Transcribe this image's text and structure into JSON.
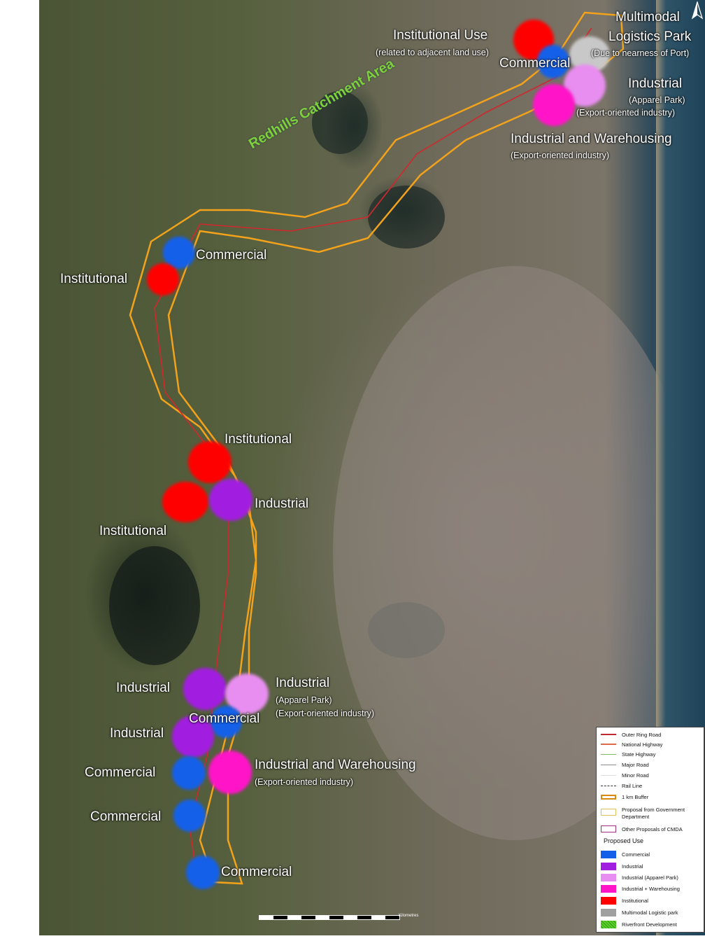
{
  "map": {
    "catchment_label": "Redhills Catchment Area",
    "labels": [
      {
        "text": "Institutional  Use",
        "size": "big"
      },
      {
        "text": "(related to adjacent land use)",
        "size": "small"
      },
      {
        "text": "Multimodal",
        "size": "big"
      },
      {
        "text": "Logistics Park",
        "size": "big"
      },
      {
        "text": "(Due to nearness of Port)",
        "size": "small"
      },
      {
        "text": "Commercial",
        "size": "big"
      },
      {
        "text": "Industrial",
        "size": "big"
      },
      {
        "text": "(Apparel Park)",
        "size": "small"
      },
      {
        "text": "(Export-oriented  industry)",
        "size": "small"
      },
      {
        "text": "Industrial and Warehousing",
        "size": "big"
      },
      {
        "text": "(Export-oriented  industry)",
        "size": "small"
      },
      {
        "text": "Commercial",
        "size": "big"
      },
      {
        "text": "Institutional",
        "size": "big"
      },
      {
        "text": "Institutional",
        "size": "big"
      },
      {
        "text": "Industrial",
        "size": "big"
      },
      {
        "text": "Institutional",
        "size": "big"
      },
      {
        "text": "Industrial",
        "size": "big"
      },
      {
        "text": "Industrial",
        "size": "big"
      },
      {
        "text": "(Apparel Park)",
        "size": "small"
      },
      {
        "text": "(Export-oriented  industry)",
        "size": "small"
      },
      {
        "text": "Commercial",
        "size": "big"
      },
      {
        "text": "Industrial",
        "size": "big"
      },
      {
        "text": "Commercial",
        "size": "big"
      },
      {
        "text": "Industrial and Warehousing",
        "size": "big"
      },
      {
        "text": "(Export-oriented  industry)",
        "size": "small"
      },
      {
        "text": "Commercial",
        "size": "big"
      },
      {
        "text": "Commercial",
        "size": "big"
      }
    ],
    "markers": [
      {
        "use": "Institutional",
        "color": "#ff0000"
      },
      {
        "use": "Multimodal Logistic park",
        "color": "#c8c8c8"
      },
      {
        "use": "Commercial",
        "color": "#1560e8"
      },
      {
        "use": "Industrial (Apparel Park)",
        "color": "#e88ef0"
      },
      {
        "use": "Industrial + Warehousing",
        "color": "#ff14c8"
      },
      {
        "use": "Commercial",
        "color": "#1560e8"
      },
      {
        "use": "Institutional",
        "color": "#ff0000"
      },
      {
        "use": "Institutional",
        "color": "#ff0000"
      },
      {
        "use": "Institutional",
        "color": "#ff0000"
      },
      {
        "use": "Industrial",
        "color": "#a11ee0"
      },
      {
        "use": "Industrial",
        "color": "#a11ee0"
      },
      {
        "use": "Industrial (Apparel Park)",
        "color": "#e88ef0"
      },
      {
        "use": "Commercial",
        "color": "#1560e8"
      },
      {
        "use": "Industrial",
        "color": "#a11ee0"
      },
      {
        "use": "Commercial",
        "color": "#1560e8"
      },
      {
        "use": "Industrial + Warehousing",
        "color": "#ff14c8"
      },
      {
        "use": "Commercial",
        "color": "#1560e8"
      },
      {
        "use": "Commercial",
        "color": "#1560e8"
      }
    ],
    "buffer_color": "#f2a21b",
    "scale_unit": "Kilometres"
  },
  "legend": {
    "lines": [
      {
        "label": "Outer Ring Road",
        "style": "solid",
        "color": "#c0282d"
      },
      {
        "label": "National Highway",
        "style": "solid",
        "color": "#e06a4a"
      },
      {
        "label": "State Highway",
        "style": "solid",
        "color": "#7cba5a"
      },
      {
        "label": "Major Road",
        "style": "solid",
        "color": "#8a8a8a"
      },
      {
        "label": "Minor Road",
        "style": "solid",
        "color": "#ffffff"
      },
      {
        "label": "Rail Line",
        "style": "dashed",
        "color": "#333333"
      },
      {
        "label": "1 km Buffer",
        "style": "box",
        "color": "#d88a10"
      },
      {
        "label": "Proposal from Government Department",
        "style": "box",
        "color": "#d9c060"
      },
      {
        "label": "Other Proposals of CMDA",
        "style": "box",
        "color": "#a0307a"
      }
    ],
    "heading": "Proposed Use",
    "uses": [
      {
        "label": "Commercial",
        "color": "#1560e8"
      },
      {
        "label": "Industrial",
        "color": "#a11ee0"
      },
      {
        "label": "Industrial (Apparel Park)",
        "color": "#e88ef0"
      },
      {
        "label": "Industrial + Warehousing",
        "color": "#ff14c8"
      },
      {
        "label": "Institutional",
        "color": "#ff0000"
      },
      {
        "label": "Multimodal Logistic park",
        "color": "#a0a0a0"
      },
      {
        "label": "Riverfront Development",
        "color": "#5ccf2a"
      }
    ]
  }
}
